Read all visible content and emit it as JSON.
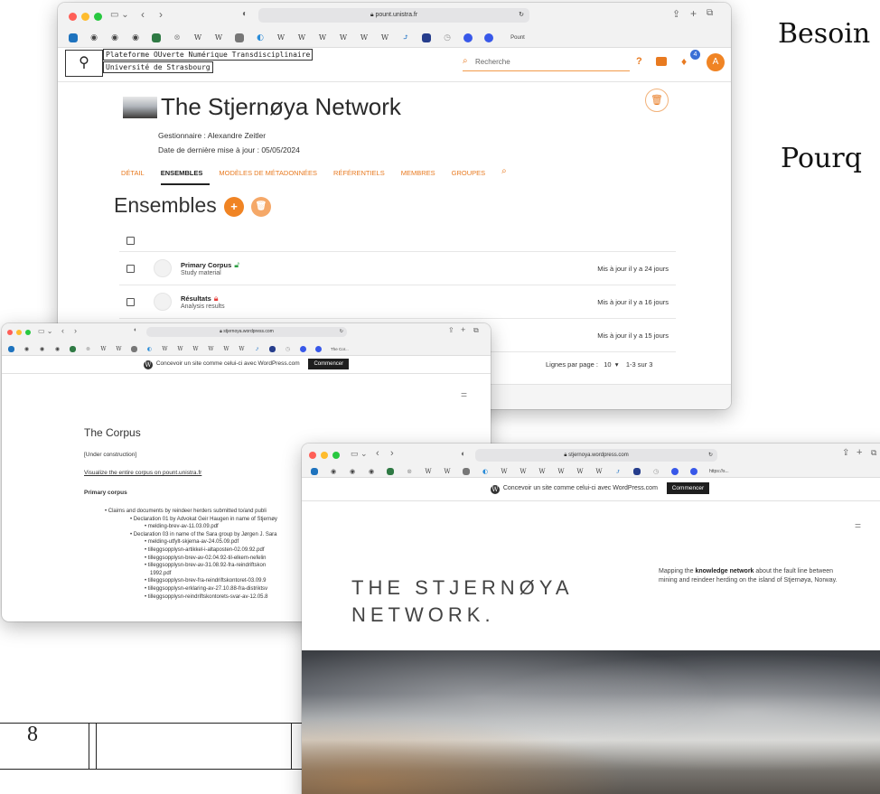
{
  "slide": {
    "side_text_1": "Besoin",
    "side_text_2": "Pourq",
    "page_number": "8"
  },
  "pount_window": {
    "url": "pount.unistra.fr",
    "bookmark_last": "Pount",
    "platform_name": "Plateforme OUverte Numérique Transdisciplinaire",
    "university": "Université de Strasbourg",
    "search_placeholder": "Recherche",
    "help": "?",
    "notif_count": "4",
    "avatar_letter": "A",
    "network_title": "The Stjernøya Network",
    "manager": "Gestionnaire : Alexandre Zeitler",
    "last_update": "Date de dernière mise à jour : 05/05/2024",
    "tabs": [
      "DÉTAIL",
      "ENSEMBLES",
      "MODÈLES DE MÉTADONNÉES",
      "RÉFÉRENTIELS",
      "MEMBRES",
      "GROUPES"
    ],
    "section_title": "Ensembles",
    "rows": [
      {
        "name": "Primary Corpus",
        "desc": "Study material",
        "updated": "Mis à jour il y a 24 jours",
        "lock": "open"
      },
      {
        "name": "Résultats",
        "desc": "Analysis results",
        "updated": "Mis à jour il y a 16 jours",
        "lock": "closed"
      },
      {
        "name": "",
        "desc": "",
        "updated": "Mis à jour il y a 15 jours",
        "lock": ""
      }
    ],
    "rows_per_page_label": "Lignes par page :",
    "rows_per_page_value": "10",
    "range": "1-3 sur 3"
  },
  "corpus_window": {
    "url": "stjernoya.wordpress.com",
    "bookmark_last": "The Cor...",
    "wp_message": "Concevoir un site comme celui-ci avec WordPress.com",
    "wp_button": "Commencer",
    "title": "The Corpus",
    "construction": "[Under construction]",
    "visualize_link": "Visualize the entire corpus on pount.unistra.fr",
    "primary_heading": "Primary corpus",
    "list": [
      "• Claims and documents by reindeer herders submitted to/and publi",
      "• Declaration 01 by Advokat Geir Haugen in name of Stjernøy",
      "• melding-brev-av-11.03.09.pdf",
      "• Declaration 03 in name of the Sara group by Jørgen J. Sara",
      "• melding-utfylt-skjema-av-24.05.09.pdf",
      "• tilleggsopplysn-artikkel-i-altaposten-02.09.92.pdf",
      "• tilleggsopplysn-brev-av-02.04.92-til-elkem-nefelin",
      "• tilleggsopplysn-brev-av-31.08.92-fra-reindriftskon",
      "1992.pdf",
      "• tilleggsopplysn-brev-fra-reindriftskontoret-03.09.9",
      "• tilleggsopplysn-erklaring-av-27.10.88-fra-distriktsv",
      "• tilleggsopplysn-reindriftskontorets-svar-av-12.05.8"
    ]
  },
  "stjernoya_window": {
    "url": "stjernoya.wordpress.com",
    "bookmark_last": "https://s...",
    "wp_message": "Concevoir un site comme celui-ci avec WordPress.com",
    "wp_button": "Commencer",
    "site_name_line1": "THE STJERNØYA",
    "site_name_line2": "NETWORK.",
    "mapping_pre": "Mapping the ",
    "mapping_bold": "knowledge network",
    "mapping_post": " about the fault line between mining and reindeer herding on the island of Stjernøya, Norway."
  },
  "colors": {
    "accent_orange": "#e87a20",
    "lock_green": "#2e9e44",
    "lock_red": "#e53935"
  }
}
